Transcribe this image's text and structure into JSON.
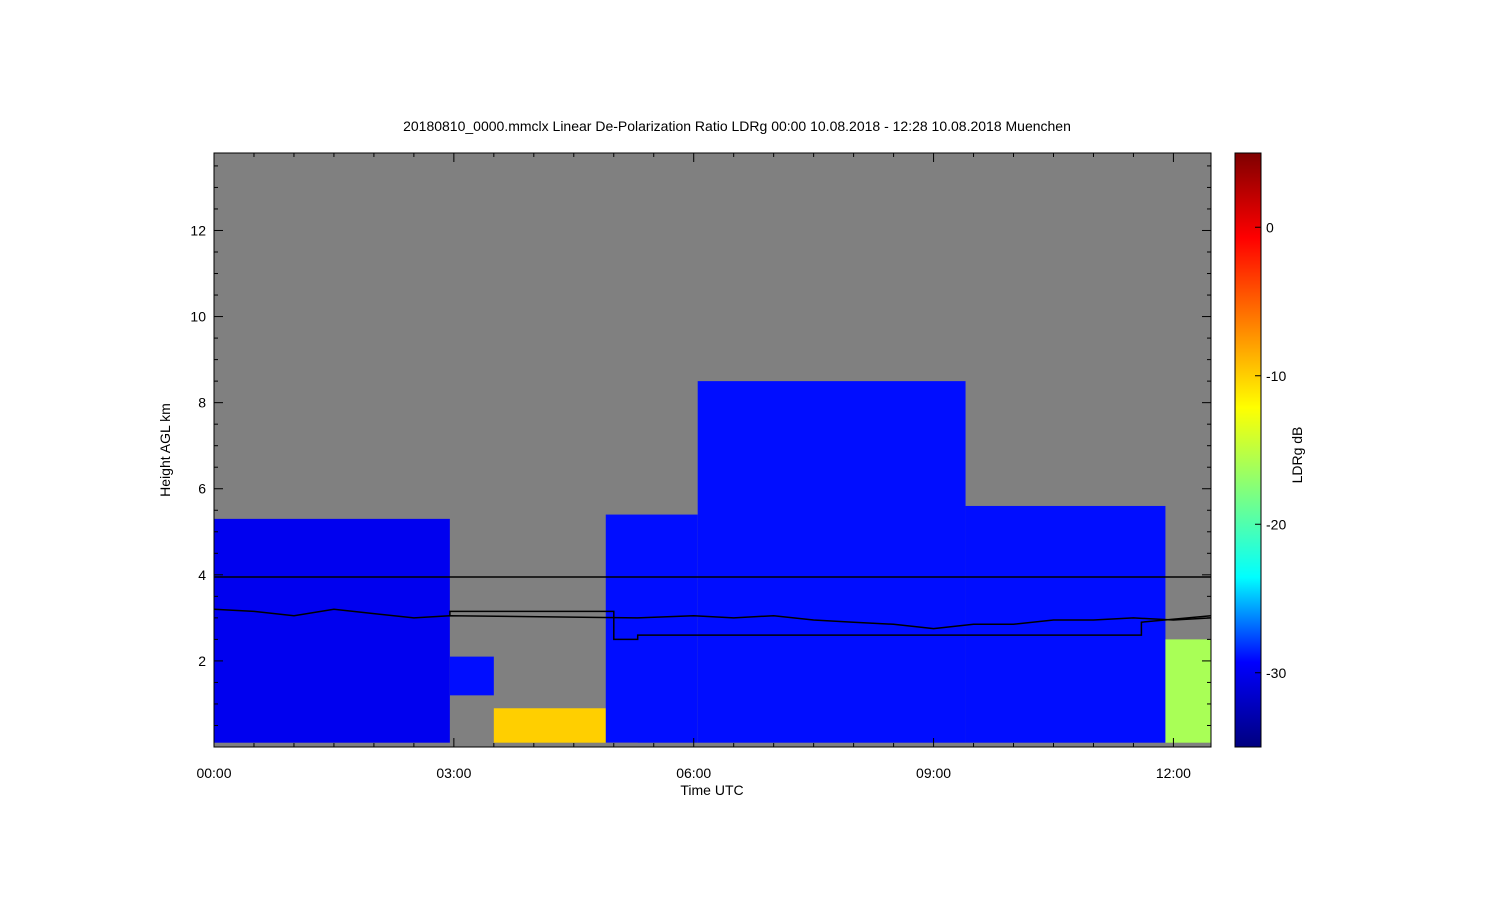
{
  "chart_data": {
    "type": "heatmap",
    "title": "20180810_0000.mmclx Linear De-Polarization Ratio LDRg   00:00 10.08.2018 - 12:28 10.08.2018 Muenchen",
    "xlabel": "Time UTC",
    "ylabel": "Height AGL km",
    "colorbar_label": "LDRg dB",
    "xlim_hours": [
      0,
      12.47
    ],
    "ylim_km": [
      0,
      13.8
    ],
    "x_ticks": [
      {
        "value": 0,
        "label": "00:00"
      },
      {
        "value": 3,
        "label": "03:00"
      },
      {
        "value": 6,
        "label": "06:00"
      },
      {
        "value": 9,
        "label": "09:00"
      },
      {
        "value": 12,
        "label": "12:00"
      }
    ],
    "y_ticks": [
      {
        "value": 2,
        "label": "2"
      },
      {
        "value": 4,
        "label": "4"
      },
      {
        "value": 6,
        "label": "6"
      },
      {
        "value": 8,
        "label": "8"
      },
      {
        "value": 10,
        "label": "10"
      },
      {
        "value": 12,
        "label": "12"
      }
    ],
    "colorbar_range": [
      -35,
      5
    ],
    "colorbar_ticks": [
      {
        "value": 0,
        "label": "0"
      },
      {
        "value": -10,
        "label": "-10"
      },
      {
        "value": -20,
        "label": "-20"
      },
      {
        "value": -30,
        "label": "-30"
      }
    ],
    "colormap": [
      "#00007f",
      "#0000ff",
      "#00ffff",
      "#7fff7f",
      "#ffff00",
      "#ff7f00",
      "#ff0000",
      "#7f0000"
    ],
    "background_color": "#808080",
    "echo_regions": [
      {
        "t0": 0.0,
        "t1": 2.95,
        "top_km": 5.3,
        "base_km": 0.1,
        "ldr_db": -30
      },
      {
        "t0": 2.95,
        "t1": 3.5,
        "top_km": 2.1,
        "base_km": 1.2,
        "ldr_db": -29
      },
      {
        "t0": 3.5,
        "t1": 5.3,
        "top_km": 0.9,
        "base_km": 0.1,
        "ldr_db": -10
      },
      {
        "t0": 4.9,
        "t1": 6.05,
        "top_km": 5.4,
        "base_km": 0.1,
        "ldr_db": -29
      },
      {
        "t0": 6.05,
        "t1": 9.4,
        "top_km": 8.5,
        "base_km": 0.1,
        "ldr_db": -29
      },
      {
        "t0": 9.4,
        "t1": 11.9,
        "top_km": 5.6,
        "base_km": 0.1,
        "ldr_db": -29
      },
      {
        "t0": 11.9,
        "t1": 12.47,
        "top_km": 2.5,
        "base_km": 0.1,
        "ldr_db": -16
      }
    ],
    "series": [
      {
        "x": [
          0,
          0.5,
          1.0,
          1.5,
          2.0,
          2.5,
          2.95,
          5.3,
          6.0,
          6.5,
          7.0,
          7.5,
          8.0,
          8.5,
          9.0,
          9.5,
          10.0,
          10.5,
          11.0,
          11.5,
          12.0,
          12.47
        ],
        "y": [
          3.2,
          3.15,
          3.05,
          3.2,
          3.1,
          3.0,
          3.05,
          3.0,
          3.05,
          3.0,
          3.05,
          2.95,
          2.9,
          2.85,
          2.75,
          2.85,
          2.85,
          2.95,
          2.95,
          3.0,
          2.95,
          3.0
        ]
      },
      {
        "x": [
          0,
          12.47
        ],
        "y": [
          3.95,
          3.95
        ]
      },
      {
        "x": [
          2.95,
          2.95,
          5.0,
          5.0,
          5.3,
          5.3,
          11.6,
          11.6,
          12.47
        ],
        "y": [
          3.05,
          3.15,
          3.15,
          2.5,
          2.5,
          2.6,
          2.6,
          2.9,
          3.05
        ]
      }
    ]
  }
}
